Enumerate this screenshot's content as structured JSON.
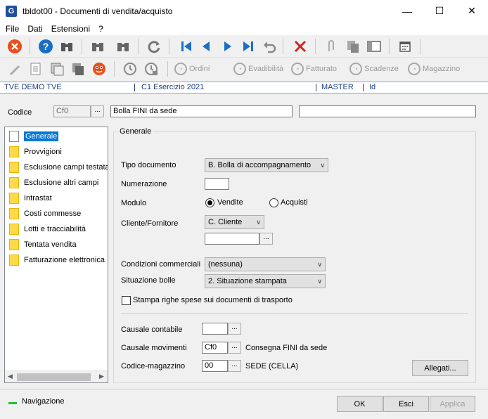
{
  "window": {
    "app_icon": "G",
    "title": "tbldot00 - Documenti di vendita/acquisto",
    "controls": [
      "minimize-icon",
      "maximize-icon",
      "close-icon"
    ]
  },
  "menu": [
    "File",
    "Dati",
    "Estensioni",
    "?"
  ],
  "toolbar2_buttons": {
    "ordini": "Ordini",
    "evadibilita": "Evadibilità",
    "fatturato": "Fatturato",
    "scadenze": "Scadenze",
    "magazzino": "Magazzino"
  },
  "infobar": {
    "company": "TVE DEMO TVE",
    "exercise": "C1 Esercizio 2021",
    "user": "MASTER",
    "id": "Id"
  },
  "codice": {
    "label": "Codice",
    "value": "Cf0",
    "description": "Bolla FINI da sede",
    "extra": ""
  },
  "tree": {
    "items": [
      "Generale",
      "Provvigioni",
      "Esclusione campi testata",
      "Esclusione altri campi",
      "Intrastat",
      "Costi commesse",
      "Lotti e tracciabilità",
      "Tentata vendita",
      "Fatturazione elettronica"
    ],
    "selected": "Generale"
  },
  "general": {
    "title": "Generale",
    "tipo_documento_label": "Tipo documento",
    "tipo_documento_value": "B. Bolla di accompagnamento",
    "numerazione_label": "Numerazione",
    "numerazione_value": "",
    "modulo_label": "Modulo",
    "modulo_vendite": "Vendite",
    "modulo_acquisti": "Acquisti",
    "cliente_label": "Cliente/Fornitore",
    "cliente_value": "C. Cliente",
    "cliente_code": "",
    "condizioni_label": "Condizioni commerciali",
    "condizioni_value": "(nessuna)",
    "situazione_label": "Situazione bolle",
    "situazione_value": "2. Situazione stampata",
    "stampa_label": "Stampa righe spese sui documenti di trasporto",
    "causale_contabile_label": "Causale contabile",
    "causale_contabile_value": "",
    "causale_movimenti_label": "Causale movimenti",
    "causale_movimenti_value": "Cf0",
    "causale_movimenti_desc": "Consegna FINI da sede",
    "codice_magazzino_label": "Codice-magazzino",
    "codice_magazzino_value": "00",
    "codice_magazzino_desc": "SEDE (CELLA)",
    "allegati": "Allegati..."
  },
  "footer": {
    "status": "Navigazione",
    "ok": "OK",
    "esci": "Esci",
    "applica": "Applica"
  },
  "colors": {
    "accent": "#0078d7",
    "status_green": "#22c030",
    "info_text": "#1f3f7f"
  }
}
